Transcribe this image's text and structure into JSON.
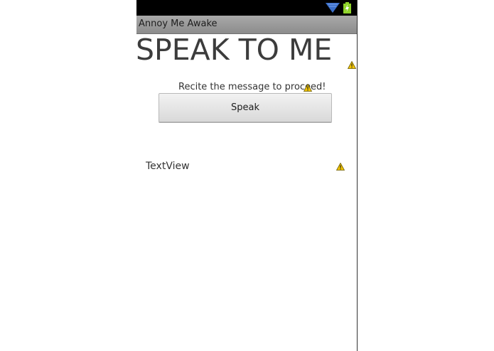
{
  "status_bar": {
    "icons": [
      "wifi-icon",
      "battery-charging-icon"
    ],
    "background": "#000000"
  },
  "title_bar": {
    "title": "Annoy Me Awake"
  },
  "main": {
    "heading": "SPEAK TO ME",
    "instruction": "Recite the message to proceed!",
    "speak_button_label": "Speak",
    "textview": "TextView",
    "warning_icon": "warning-icon"
  },
  "colors": {
    "wifi": "#3b6fc9",
    "battery": "#8fd32a",
    "title_bar": "#a0a0a0",
    "warning": "#f2c400"
  }
}
